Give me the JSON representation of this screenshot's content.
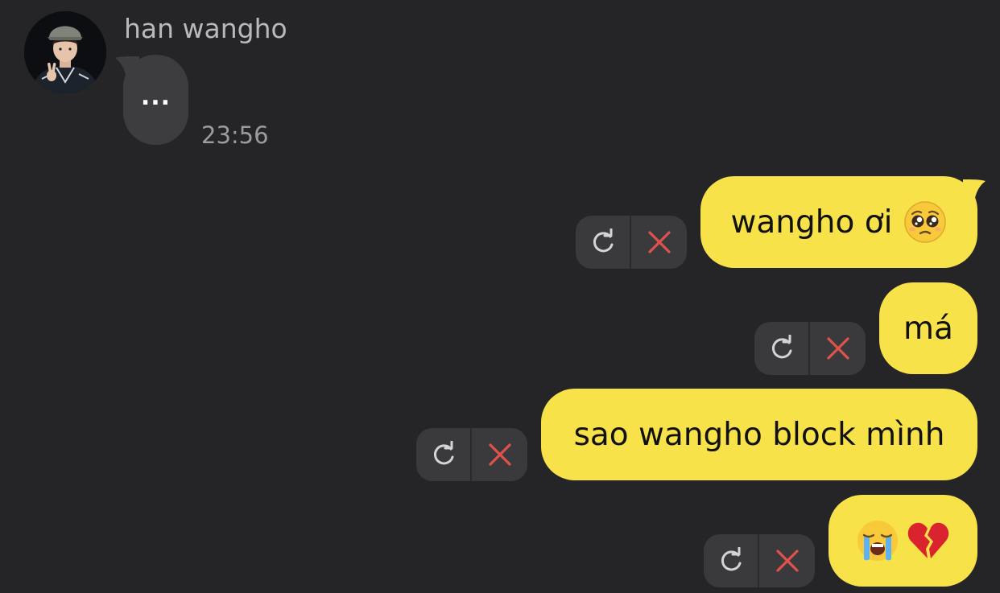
{
  "sender": {
    "name": "han wangho",
    "avatar_icon": "profile-photo"
  },
  "incoming": {
    "typing_text": "...",
    "time": "23:56"
  },
  "outgoing_messages": [
    {
      "text": "wangho ơi",
      "emoji": "pleading-face-emoji"
    },
    {
      "text": "má",
      "emoji": ""
    },
    {
      "text": "sao wangho block mình",
      "emoji": ""
    },
    {
      "text": "",
      "emoji": "loudly-crying-face-emoji broken-heart-emoji"
    }
  ],
  "actions": {
    "retry_icon": "retry-icon",
    "delete_icon": "delete-x-icon"
  },
  "colors": {
    "background": "#252527",
    "incoming_bubble": "#3d3d40",
    "outgoing_bubble": "#f8e24a",
    "delete_red": "#e0524c"
  }
}
